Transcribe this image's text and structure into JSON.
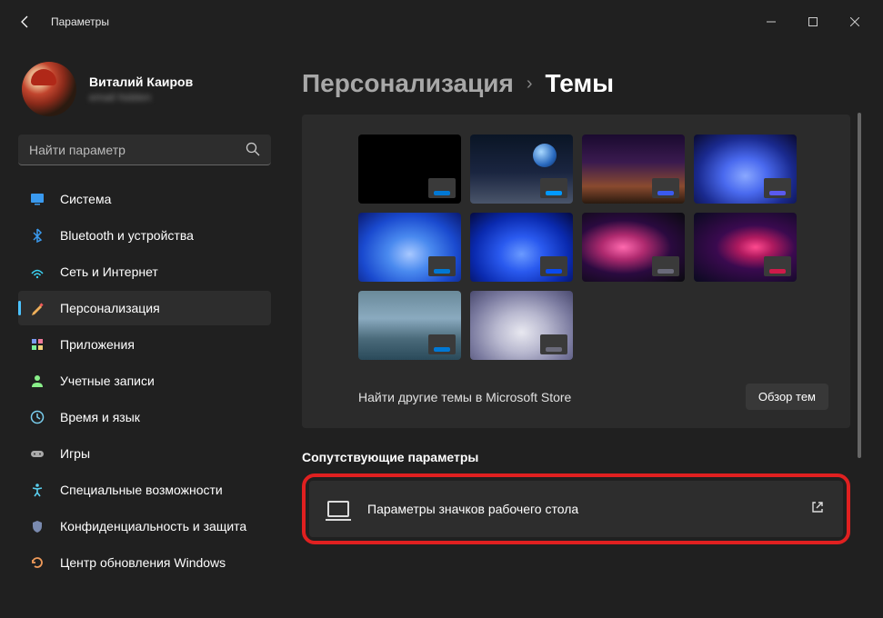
{
  "window": {
    "title": "Параметры"
  },
  "user": {
    "name": "Виталий Каиров",
    "email": "email hidden"
  },
  "search": {
    "placeholder": "Найти параметр"
  },
  "nav": [
    {
      "label": "Система",
      "icon": "system"
    },
    {
      "label": "Bluetooth и устройства",
      "icon": "bluetooth"
    },
    {
      "label": "Сеть и Интернет",
      "icon": "network"
    },
    {
      "label": "Персонализация",
      "icon": "personalize",
      "active": true
    },
    {
      "label": "Приложения",
      "icon": "apps"
    },
    {
      "label": "Учетные записи",
      "icon": "accounts"
    },
    {
      "label": "Время и язык",
      "icon": "time"
    },
    {
      "label": "Игры",
      "icon": "gaming"
    },
    {
      "label": "Специальные возможности",
      "icon": "accessibility"
    },
    {
      "label": "Конфиденциальность и защита",
      "icon": "privacy"
    },
    {
      "label": "Центр обновления Windows",
      "icon": "update"
    }
  ],
  "breadcrumb": {
    "parent": "Персонализация",
    "current": "Темы"
  },
  "themes": {
    "tiles": [
      {
        "bg": "t0",
        "accent": "#0078d4"
      },
      {
        "bg": "t1",
        "accent": "#0099ff"
      },
      {
        "bg": "t2",
        "accent": "#3a5aef"
      },
      {
        "bg": "t3",
        "accent": "#5a5aef"
      },
      {
        "bg": "t4",
        "accent": "#0078d4"
      },
      {
        "bg": "t5",
        "accent": "#0a4aef"
      },
      {
        "bg": "t6",
        "accent": "#6a6a7a"
      },
      {
        "bg": "t7",
        "accent": "#cf1a4a"
      },
      {
        "bg": "t8",
        "accent": "#0078d4"
      },
      {
        "bg": "t9",
        "accent": "#6a6a7a"
      }
    ],
    "store_text": "Найти другие темы в Microsoft Store",
    "store_button": "Обзор тем"
  },
  "related": {
    "section_label": "Сопутствующие параметры",
    "desktop_icons": "Параметры значков рабочего стола"
  }
}
